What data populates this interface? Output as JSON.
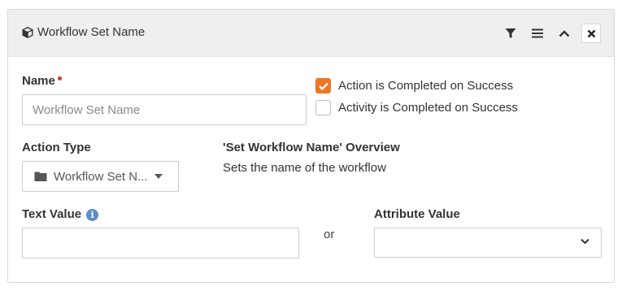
{
  "panel": {
    "title": "Workflow Set Name",
    "title_icon": "cube-icon",
    "actions": [
      "filter-icon",
      "reorder-icon",
      "chevron-up-icon",
      "close-icon"
    ]
  },
  "form": {
    "name": {
      "label": "Name",
      "required": true,
      "value": "",
      "placeholder": "Workflow Set Name"
    },
    "checkboxes": [
      {
        "label": "Action is Completed on Success",
        "checked": true
      },
      {
        "label": "Activity is Completed on Success",
        "checked": false
      }
    ],
    "action_type": {
      "label": "Action Type",
      "selected": "Workflow Set N...",
      "icon": "folder-icon"
    },
    "overview": {
      "title": "'Set Workflow Name' Overview",
      "description": "Sets the name of the workflow"
    },
    "text_value": {
      "label": "Text Value",
      "value": "",
      "info_icon": "info-icon"
    },
    "or_label": "or",
    "attribute_value": {
      "label": "Attribute Value",
      "selected": ""
    }
  },
  "colors": {
    "accent": "#ee7625",
    "required": "#d23a2a",
    "info": "#5b8ec7",
    "header_bg": "#efefef"
  }
}
